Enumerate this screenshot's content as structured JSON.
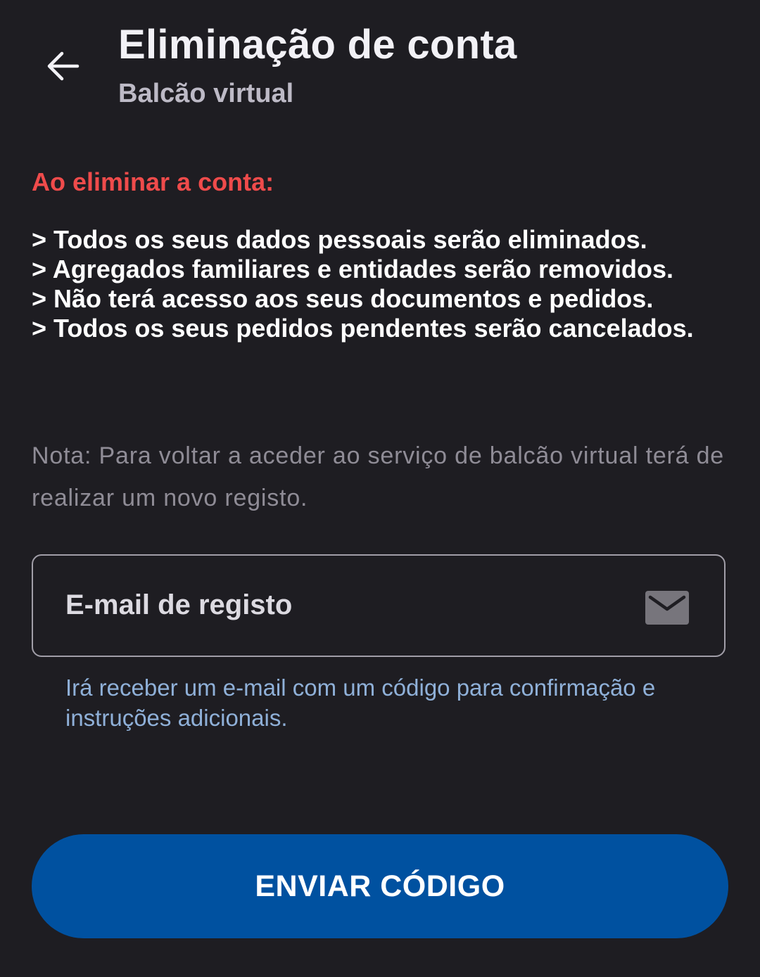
{
  "header": {
    "title": "Eliminação de conta",
    "subtitle": "Balcão virtual",
    "back_icon": "arrow-left-icon"
  },
  "warning": {
    "heading": "Ao eliminar a conta:",
    "items": [
      "> Todos os seus dados pessoais serão eliminados.",
      "> Agregados familiares e entidades serão removidos.",
      "> Não terá acesso aos seus documentos e pedidos.",
      "> Todos os seus pedidos pendentes serão cancelados."
    ]
  },
  "note": "Nota: Para voltar a aceder ao serviço de balcão virtual terá de realizar um novo registo.",
  "email_field": {
    "label": "E-mail de registo",
    "value": "",
    "icon": "mail-icon",
    "helper": "Irá receber um e-mail com um código para confirmação e instruções adicionais."
  },
  "actions": {
    "send_code": "ENVIAR CÓDIGO"
  },
  "colors": {
    "background": "#1e1d22",
    "warning": "#ef4b4b",
    "helper": "#8fb0d8",
    "primary": "#0051a0"
  }
}
